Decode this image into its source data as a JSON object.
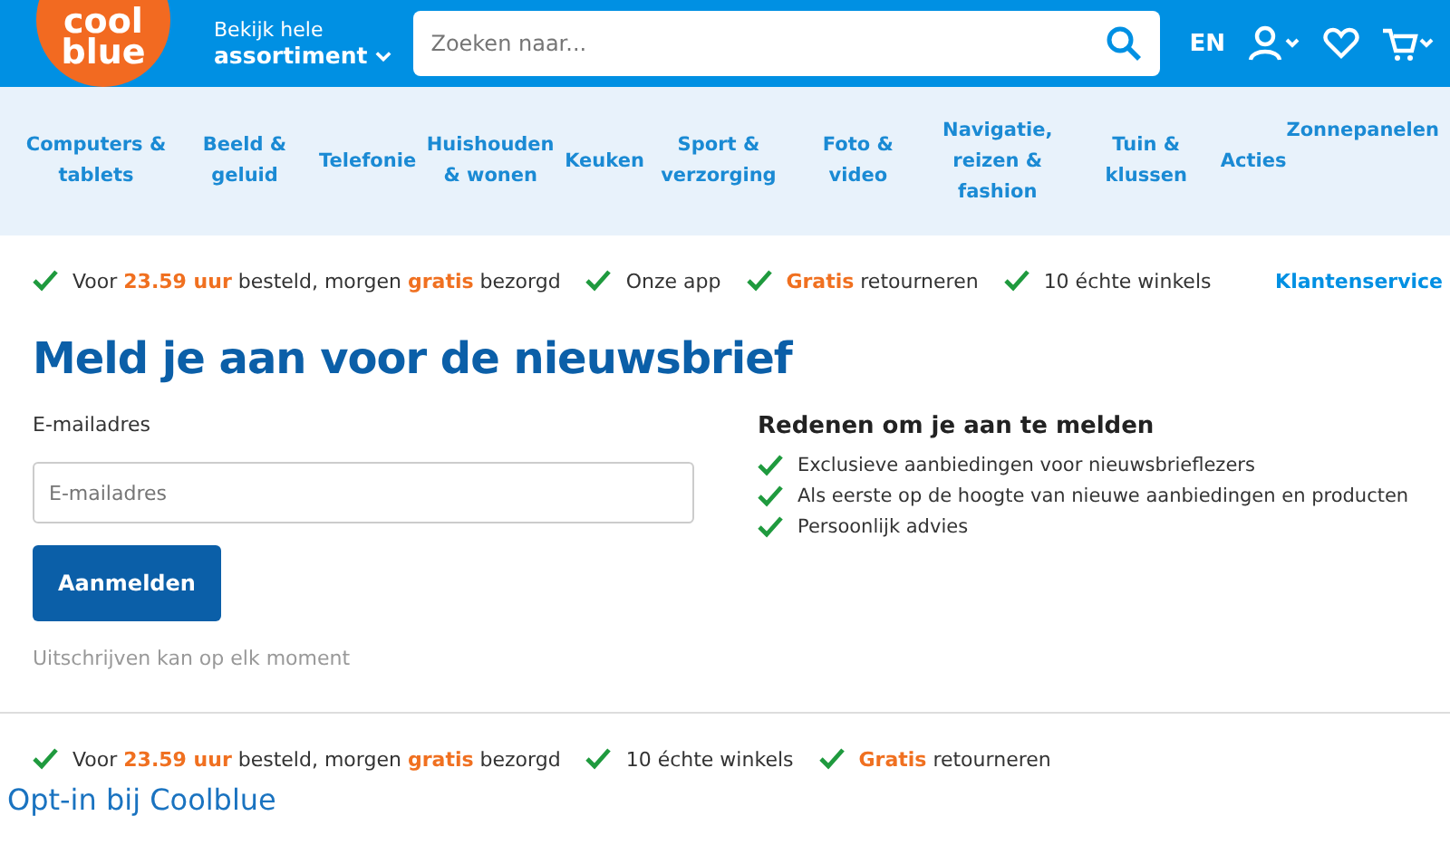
{
  "header": {
    "logo": [
      "cool",
      "blue"
    ],
    "menu": [
      "Bekijk hele",
      "assortiment"
    ],
    "search": {
      "placeholder": "Zoeken naar..."
    },
    "language": "EN"
  },
  "nav": [
    "Computers & tablets",
    "Beeld & geluid",
    "Telefonie",
    "Huishouden & wonen",
    "Keuken",
    "Sport & verzorging",
    "Foto & video",
    "Navigatie, reizen & fashion",
    "Tuin & klussen",
    "Acties",
    "Zonnepanelen"
  ],
  "usps_top": [
    "Voor **23.59 uur** besteld, morgen **gratis** bezorgd",
    "Onze app",
    "**Gratis** retourneren",
    "10 échte winkels"
  ],
  "customer_service": "Klantenservice",
  "title": "Meld je aan voor de nieuwsbrief",
  "form": {
    "label": "E-mailadres",
    "placeholder": "E-mailadres",
    "button": "Aanmelden",
    "note": "Uitschrijven kan op elk moment"
  },
  "reasons": {
    "title": "Redenen om je aan te melden",
    "items": [
      "Exclusieve aanbiedingen voor nieuwsbrieflezers",
      "Als eerste op de hoogte van nieuwe aanbiedingen en producten",
      "Persoonlijk advies"
    ]
  },
  "usps_bottom": [
    "Voor **23.59 uur** besteld, morgen **gratis** bezorgd",
    "10 échte winkels",
    "**Gratis** retourneren"
  ],
  "caption": "Opt-in bij Coolblue"
}
